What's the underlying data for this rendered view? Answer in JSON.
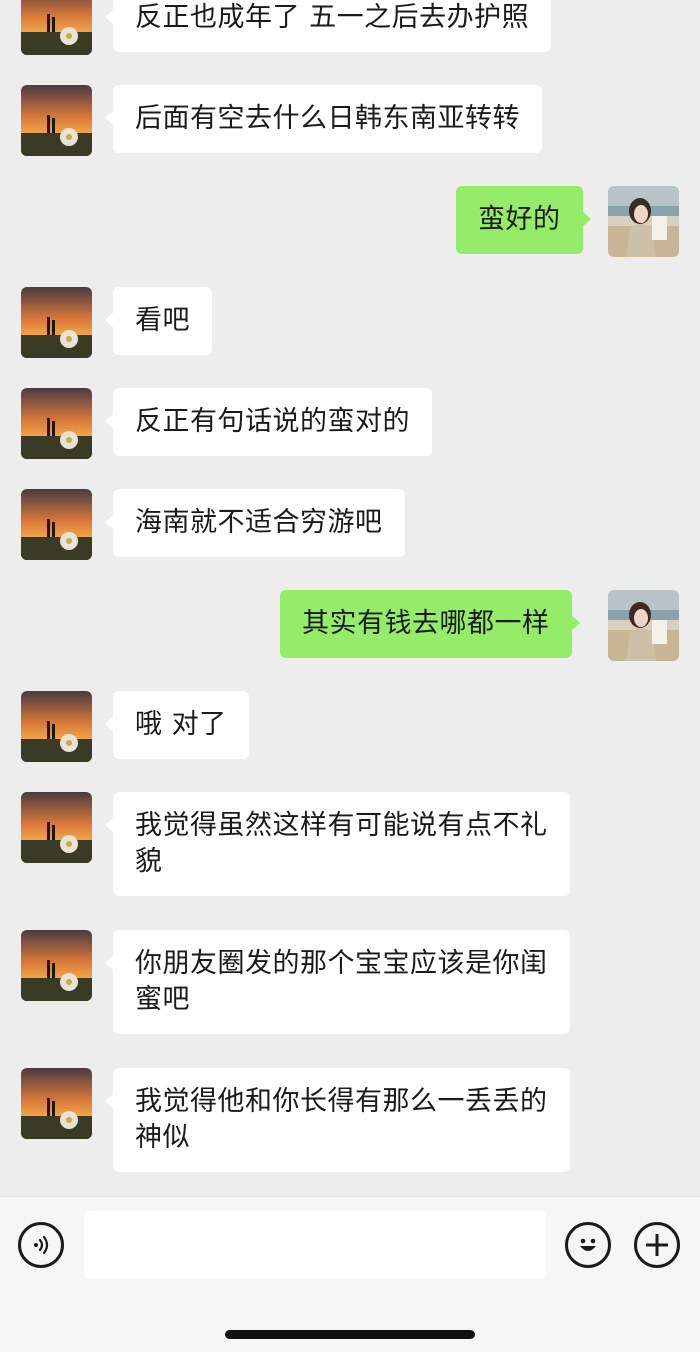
{
  "messages": [
    {
      "side": "in",
      "text": "反正也成年了 五一之后去办护照"
    },
    {
      "side": "in",
      "text": "后面有空去什么日韩东南亚转转"
    },
    {
      "side": "out",
      "text": "蛮好的"
    },
    {
      "side": "in",
      "text": "看吧"
    },
    {
      "side": "in",
      "text": "反正有句话说的蛮对的"
    },
    {
      "side": "in",
      "text": "海南就不适合穷游吧"
    },
    {
      "side": "out",
      "text": "其实有钱去哪都一样"
    },
    {
      "side": "in",
      "text": "哦 对了"
    },
    {
      "side": "in",
      "text": "我觉得虽然这样有可能说有点不礼\n貌"
    },
    {
      "side": "in",
      "text": "你朋友圈发的那个宝宝应该是你闺\n蜜吧"
    },
    {
      "side": "in",
      "text": "我觉得他和你长得有那么一丢丢的\n神似"
    }
  ],
  "input": {
    "value": "",
    "voice_icon": "voice-icon",
    "emoji_icon": "emoji-icon",
    "plus_icon": "plus-icon"
  },
  "colors": {
    "background": "#ededed",
    "incoming_bubble": "#ffffff",
    "outgoing_bubble": "#95ec69"
  }
}
